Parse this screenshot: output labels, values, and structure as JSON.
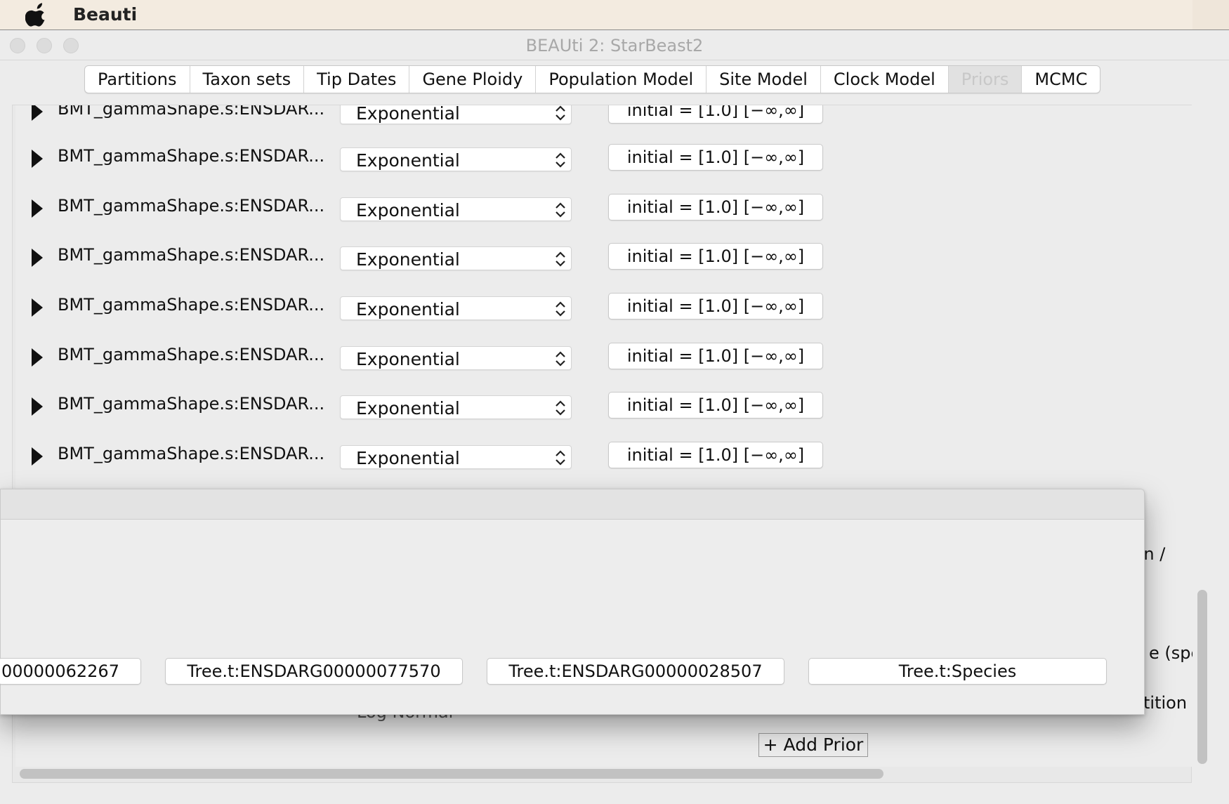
{
  "menubar": {
    "app_name": "Beauti",
    "apple_icon": "apple-logo-icon"
  },
  "window": {
    "title": "BEAUti 2: StarBeast2"
  },
  "tabs": [
    {
      "label": "Partitions",
      "active": false
    },
    {
      "label": "Taxon sets",
      "active": false
    },
    {
      "label": "Tip Dates",
      "active": false
    },
    {
      "label": "Gene Ploidy",
      "active": false
    },
    {
      "label": "Population Model",
      "active": false
    },
    {
      "label": "Site Model",
      "active": false
    },
    {
      "label": "Clock Model",
      "active": false
    },
    {
      "label": "Priors",
      "active": true
    },
    {
      "label": "MCMC",
      "active": false
    }
  ],
  "priors": [
    {
      "name": "BMT_gammaShape.s:ENSDAR...",
      "distribution": "Exponential",
      "initial": "initial = [1.0] [−∞,∞]"
    },
    {
      "name": "BMT_gammaShape.s:ENSDAR...",
      "distribution": "Exponential",
      "initial": "initial = [1.0] [−∞,∞]"
    },
    {
      "name": "BMT_gammaShape.s:ENSDAR...",
      "distribution": "Exponential",
      "initial": "initial = [1.0] [−∞,∞]"
    },
    {
      "name": "BMT_gammaShape.s:ENSDAR...",
      "distribution": "Exponential",
      "initial": "initial = [1.0] [−∞,∞]"
    },
    {
      "name": "BMT_gammaShape.s:ENSDAR...",
      "distribution": "Exponential",
      "initial": "initial = [1.0] [−∞,∞]"
    },
    {
      "name": "BMT_gammaShape.s:ENSDAR...",
      "distribution": "Exponential",
      "initial": "initial = [1.0] [−∞,∞]"
    },
    {
      "name": "BMT_gammaShape.s:ENSDAR...",
      "distribution": "Exponential",
      "initial": "initial = [1.0] [−∞,∞]"
    },
    {
      "name": "BMT_gammaShape.s:ENSDAR...",
      "distribution": "Exponential",
      "initial": "initial = [1.0] [−∞,∞]"
    }
  ],
  "behind_popup": {
    "partial_text_1": "ion /",
    "partial_text_2": "e (spe",
    "partial_text_3": "tition",
    "partial_dist": "Log Normal"
  },
  "add_prior_label": "+ Add Prior",
  "popup": {
    "tree_buttons": [
      "00000062267",
      "Tree.t:ENSDARG00000077570",
      "Tree.t:ENSDARG00000028507",
      "Tree.t:Species"
    ]
  }
}
